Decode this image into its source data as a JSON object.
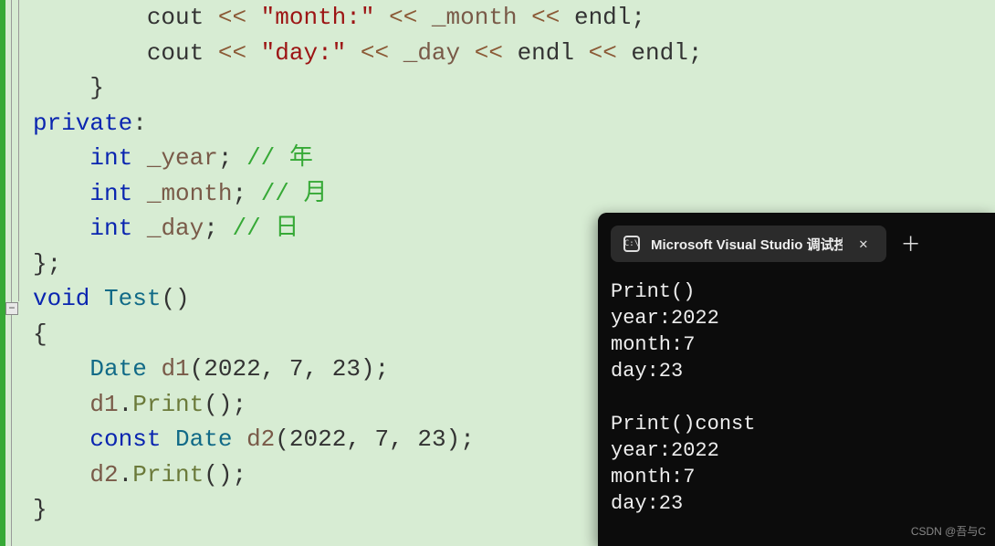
{
  "code": {
    "lines": [
      {
        "indent": "        ",
        "tokens": [
          {
            "t": "cout",
            "c": "tk-text"
          },
          {
            "t": " << ",
            "c": "tk-op"
          },
          {
            "t": "\"month:\"",
            "c": "tk-str"
          },
          {
            "t": " << ",
            "c": "tk-op"
          },
          {
            "t": "_month",
            "c": "tk-id"
          },
          {
            "t": " << ",
            "c": "tk-op"
          },
          {
            "t": "endl",
            "c": "tk-text"
          },
          {
            "t": ";",
            "c": "tk-punct"
          }
        ]
      },
      {
        "indent": "        ",
        "tokens": [
          {
            "t": "cout",
            "c": "tk-text"
          },
          {
            "t": " << ",
            "c": "tk-op"
          },
          {
            "t": "\"day:\"",
            "c": "tk-str"
          },
          {
            "t": " << ",
            "c": "tk-op"
          },
          {
            "t": "_day",
            "c": "tk-id"
          },
          {
            "t": " << ",
            "c": "tk-op"
          },
          {
            "t": "endl",
            "c": "tk-text"
          },
          {
            "t": " << ",
            "c": "tk-op"
          },
          {
            "t": "endl",
            "c": "tk-text"
          },
          {
            "t": ";",
            "c": "tk-punct"
          }
        ]
      },
      {
        "indent": "    ",
        "tokens": [
          {
            "t": "}",
            "c": "tk-punct"
          }
        ]
      },
      {
        "indent": "",
        "tokens": [
          {
            "t": "private",
            "c": "tk-kw"
          },
          {
            "t": ":",
            "c": "tk-punct"
          }
        ]
      },
      {
        "indent": "    ",
        "tokens": [
          {
            "t": "int",
            "c": "tk-kw"
          },
          {
            "t": " ",
            "c": "tk-text"
          },
          {
            "t": "_year",
            "c": "tk-id"
          },
          {
            "t": "; ",
            "c": "tk-punct"
          },
          {
            "t": "// 年",
            "c": "tk-comment"
          }
        ]
      },
      {
        "indent": "    ",
        "tokens": [
          {
            "t": "int",
            "c": "tk-kw"
          },
          {
            "t": " ",
            "c": "tk-text"
          },
          {
            "t": "_month",
            "c": "tk-id"
          },
          {
            "t": "; ",
            "c": "tk-punct"
          },
          {
            "t": "// 月",
            "c": "tk-comment"
          }
        ]
      },
      {
        "indent": "    ",
        "tokens": [
          {
            "t": "int",
            "c": "tk-kw"
          },
          {
            "t": " ",
            "c": "tk-text"
          },
          {
            "t": "_day",
            "c": "tk-id"
          },
          {
            "t": "; ",
            "c": "tk-punct"
          },
          {
            "t": "// 日",
            "c": "tk-comment"
          }
        ]
      },
      {
        "indent": "",
        "tokens": [
          {
            "t": "};",
            "c": "tk-punct"
          }
        ]
      },
      {
        "indent": "",
        "tokens": [
          {
            "t": "void",
            "c": "tk-kw"
          },
          {
            "t": " ",
            "c": "tk-text"
          },
          {
            "t": "Test",
            "c": "tk-type"
          },
          {
            "t": "()",
            "c": "tk-punct"
          }
        ]
      },
      {
        "indent": "",
        "tokens": [
          {
            "t": "{",
            "c": "tk-punct"
          }
        ]
      },
      {
        "indent": "    ",
        "tokens": [
          {
            "t": "Date",
            "c": "tk-type"
          },
          {
            "t": " ",
            "c": "tk-text"
          },
          {
            "t": "d1",
            "c": "tk-id"
          },
          {
            "t": "(",
            "c": "tk-punct"
          },
          {
            "t": "2022",
            "c": "tk-num"
          },
          {
            "t": ", ",
            "c": "tk-punct"
          },
          {
            "t": "7",
            "c": "tk-num"
          },
          {
            "t": ", ",
            "c": "tk-punct"
          },
          {
            "t": "23",
            "c": "tk-num"
          },
          {
            "t": ");",
            "c": "tk-punct"
          }
        ]
      },
      {
        "indent": "    ",
        "tokens": [
          {
            "t": "d1",
            "c": "tk-id"
          },
          {
            "t": ".",
            "c": "tk-punct"
          },
          {
            "t": "Print",
            "c": "tk-func"
          },
          {
            "t": "();",
            "c": "tk-punct"
          }
        ]
      },
      {
        "indent": "    ",
        "tokens": [
          {
            "t": "const",
            "c": "tk-kw"
          },
          {
            "t": " ",
            "c": "tk-text"
          },
          {
            "t": "Date",
            "c": "tk-type"
          },
          {
            "t": " ",
            "c": "tk-text"
          },
          {
            "t": "d2",
            "c": "tk-id"
          },
          {
            "t": "(",
            "c": "tk-punct"
          },
          {
            "t": "2022",
            "c": "tk-num"
          },
          {
            "t": ", ",
            "c": "tk-punct"
          },
          {
            "t": "7",
            "c": "tk-num"
          },
          {
            "t": ", ",
            "c": "tk-punct"
          },
          {
            "t": "23",
            "c": "tk-num"
          },
          {
            "t": ");",
            "c": "tk-punct"
          }
        ]
      },
      {
        "indent": "    ",
        "tokens": [
          {
            "t": "d2",
            "c": "tk-id"
          },
          {
            "t": ".",
            "c": "tk-punct"
          },
          {
            "t": "Print",
            "c": "tk-func"
          },
          {
            "t": "();",
            "c": "tk-punct"
          }
        ]
      },
      {
        "indent": "",
        "tokens": [
          {
            "t": "}",
            "c": "tk-punct"
          }
        ]
      }
    ],
    "fold_minus_top": 331
  },
  "terminal": {
    "title": "Microsoft Visual Studio 调试控",
    "close": "✕",
    "newtab": "＋",
    "icon_text": "C:\\",
    "output": "Print()\nyear:2022\nmonth:7\nday:23\n\nPrint()const\nyear:2022\nmonth:7\nday:23"
  },
  "watermark": "CSDN @吾与C"
}
